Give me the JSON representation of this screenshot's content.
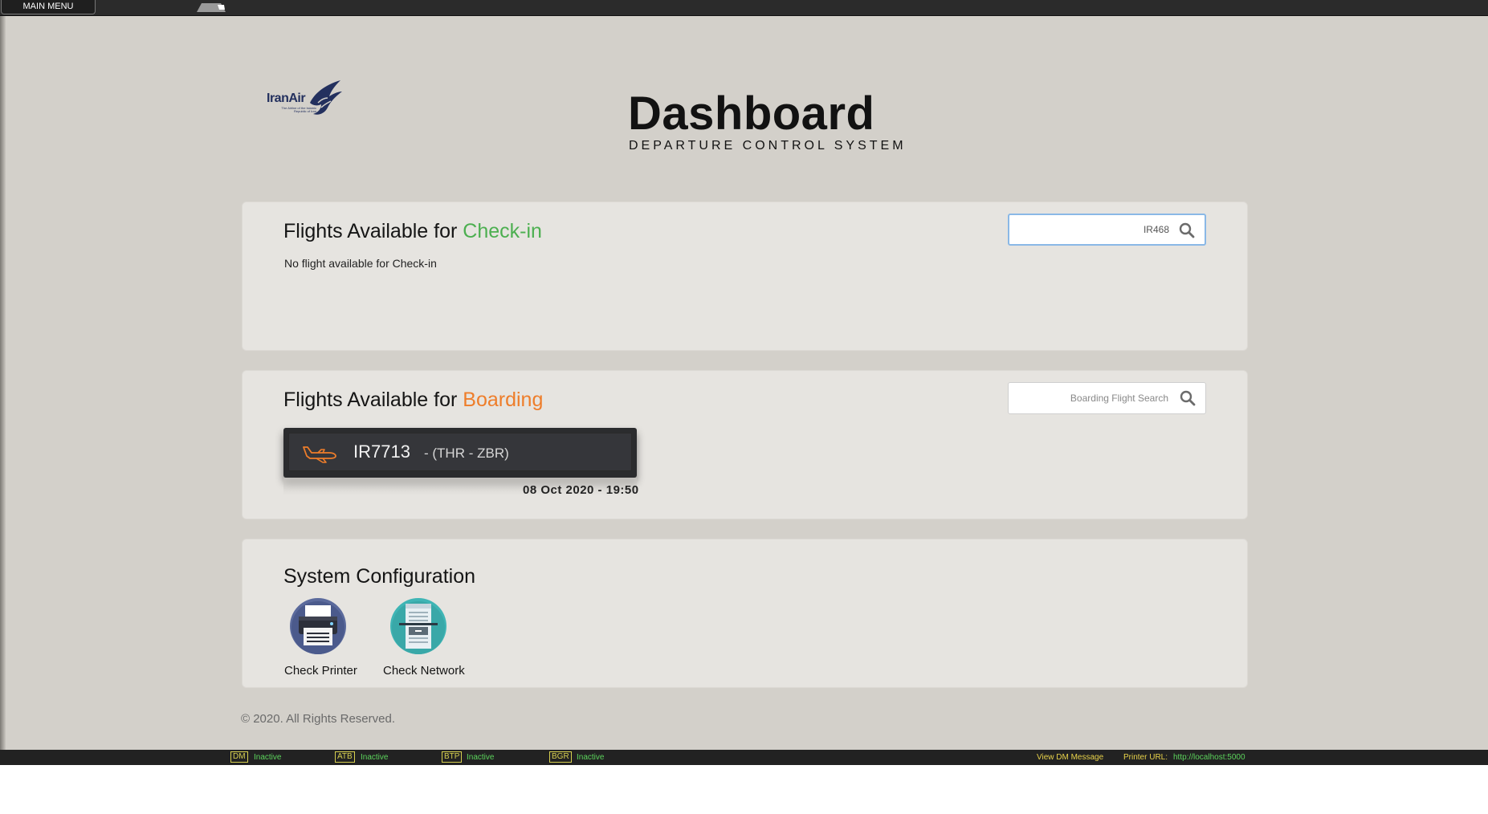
{
  "topbar": {
    "main_menu_label": "MAIN MENU"
  },
  "header": {
    "logo_text": "IranAir",
    "logo_subtext": "The Airline of the Islamic Republic of Iran",
    "title": "Dashboard",
    "subtitle": "DEPARTURE CONTROL SYSTEM"
  },
  "checkin": {
    "title_prefix": "Flights Available for ",
    "title_accent": "Check-in",
    "empty_message": "No flight available for Check-in",
    "search_value": "IR468",
    "search_placeholder": ""
  },
  "boarding": {
    "title_prefix": "Flights Available for ",
    "title_accent": "Boarding",
    "search_value": "",
    "search_placeholder": "Boarding Flight Search",
    "flights": [
      {
        "flight_no": "IR7713",
        "route": "- (THR - ZBR)",
        "datetime": "08 Oct 2020 - 19:50"
      }
    ]
  },
  "config": {
    "title": "System Configuration",
    "items": [
      {
        "label": "Check Printer",
        "icon": "printer-icon"
      },
      {
        "label": "Check Network",
        "icon": "network-icon"
      }
    ]
  },
  "footer": {
    "copyright": "© 2020. All Rights Reserved."
  },
  "statusbar": {
    "items": [
      {
        "key": "DM",
        "status": "Inactive"
      },
      {
        "key": "ATB",
        "status": "Inactive"
      },
      {
        "key": "BTP",
        "status": "Inactive"
      },
      {
        "key": "BGR",
        "status": "Inactive"
      }
    ],
    "view_dm_message": "View DM Message",
    "printer_url_label": "Printer URL:",
    "printer_url": "http://localhost:5000"
  },
  "colors": {
    "checkin_accent": "#4caf50",
    "boarding_accent": "#ee7d2a",
    "status_key": "#d7cf4f",
    "status_value": "#5cd45c"
  }
}
